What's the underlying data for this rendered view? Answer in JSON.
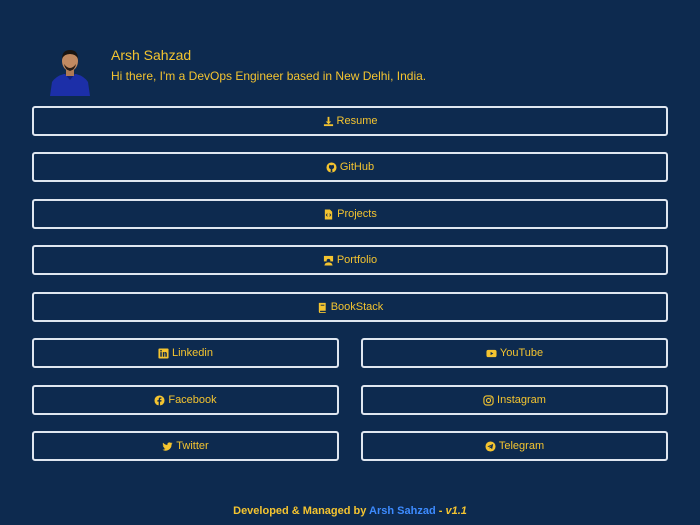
{
  "profile": {
    "name": "Arsh Sahzad",
    "tagline": "Hi there, I'm a DevOps Engineer based in New Delhi, India."
  },
  "links": {
    "resume": {
      "label": "Resume",
      "icon": "download-icon"
    },
    "github": {
      "label": "GitHub",
      "icon": "github-icon"
    },
    "projects": {
      "label": "Projects",
      "icon": "file-code-icon"
    },
    "portfolio": {
      "label": "Portfolio",
      "icon": "portfolio-icon"
    },
    "bookstack": {
      "label": "BookStack",
      "icon": "book-icon"
    },
    "linkedin": {
      "label": "Linkedin",
      "icon": "linkedin-icon"
    },
    "youtube": {
      "label": "YouTube",
      "icon": "youtube-icon"
    },
    "facebook": {
      "label": "Facebook",
      "icon": "facebook-icon"
    },
    "instagram": {
      "label": "Instagram",
      "icon": "instagram-icon"
    },
    "twitter": {
      "label": "Twitter",
      "icon": "twitter-icon"
    },
    "telegram": {
      "label": "Telegram",
      "icon": "telegram-icon"
    }
  },
  "footer": {
    "prefix": "Developed & Managed by ",
    "author": "Arsh Sahzad",
    "separator": " - ",
    "version": "v1.1"
  },
  "colors": {
    "background": "#0d2a4f",
    "accent": "#f4c430",
    "border": "#dfe6f0",
    "author_link": "#3d8bff"
  }
}
